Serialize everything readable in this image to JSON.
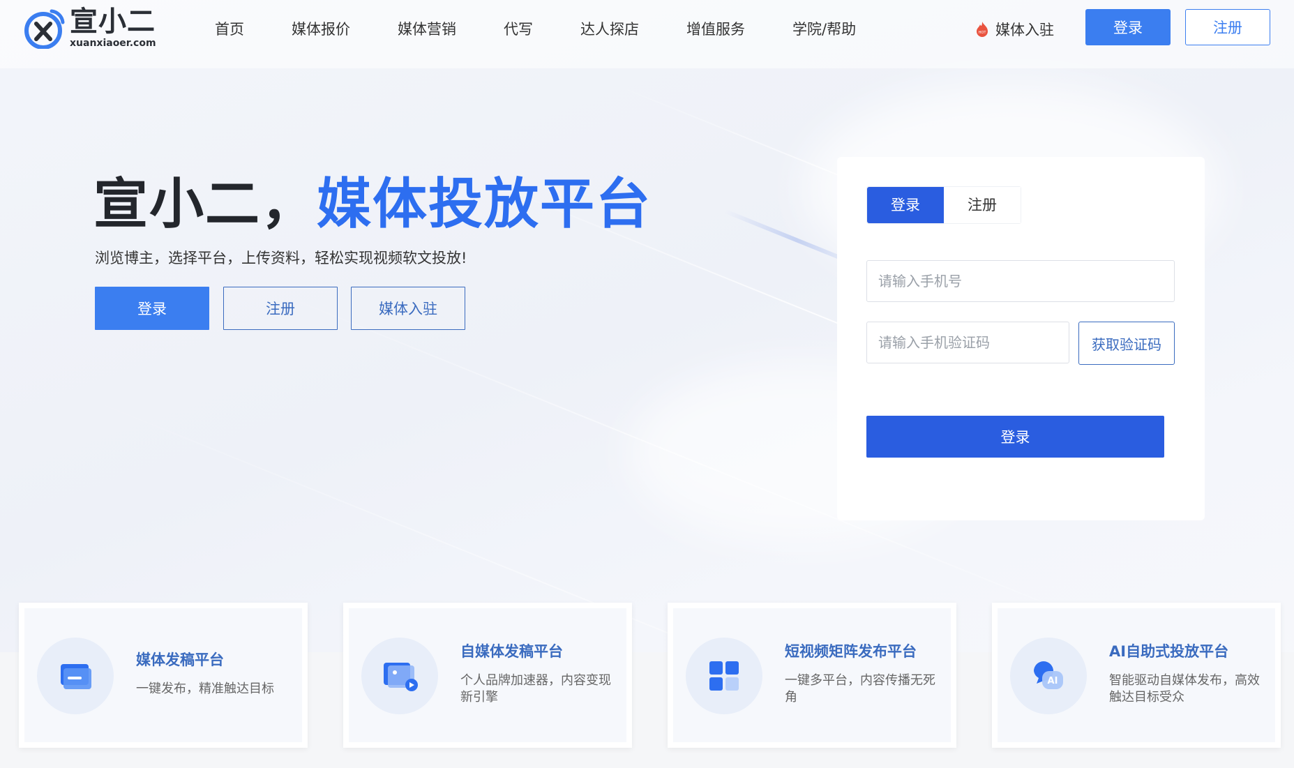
{
  "brand": {
    "name_cn": "宣小二",
    "domain": "xuanxiaoer.com"
  },
  "nav": {
    "items": [
      "首页",
      "媒体报价",
      "媒体营销",
      "代写",
      "达人探店",
      "增值服务",
      "学院/帮助"
    ],
    "media_join": "媒体入驻",
    "hot_badge": "HOT",
    "login": "登录",
    "register": "注册"
  },
  "hero": {
    "title_dark": "宣小二，",
    "title_blue": "媒体投放平台",
    "subtitle": "浏览博主，选择平台，上传资料，轻松实现视频软文投放!",
    "btn_login": "登录",
    "btn_register": "注册",
    "btn_join": "媒体入驻"
  },
  "login_card": {
    "tab_login": "登录",
    "tab_register": "注册",
    "phone_placeholder": "请输入手机号",
    "code_placeholder": "请输入手机验证码",
    "get_code": "获取验证码",
    "submit": "登录"
  },
  "features": [
    {
      "title": "媒体发稿平台",
      "desc": "一键发布，精准触达目标",
      "icon": "document-card-icon"
    },
    {
      "title": "自媒体发稿平台",
      "desc": "个人品牌加速器，内容变现新引擎",
      "icon": "video-card-icon"
    },
    {
      "title": "短视频矩阵发布平台",
      "desc": "一键多平台，内容传播无死角",
      "icon": "grid-icon"
    },
    {
      "title": "AI自助式投放平台",
      "desc": "智能驱动自媒体发布，高效触达目标受众",
      "icon": "ai-chat-icon"
    }
  ],
  "colors": {
    "primary": "#3b7ef0",
    "primary_dark": "#2a5de0",
    "title_blue": "#2d6ef0",
    "link_blue": "#3a6bbf"
  }
}
